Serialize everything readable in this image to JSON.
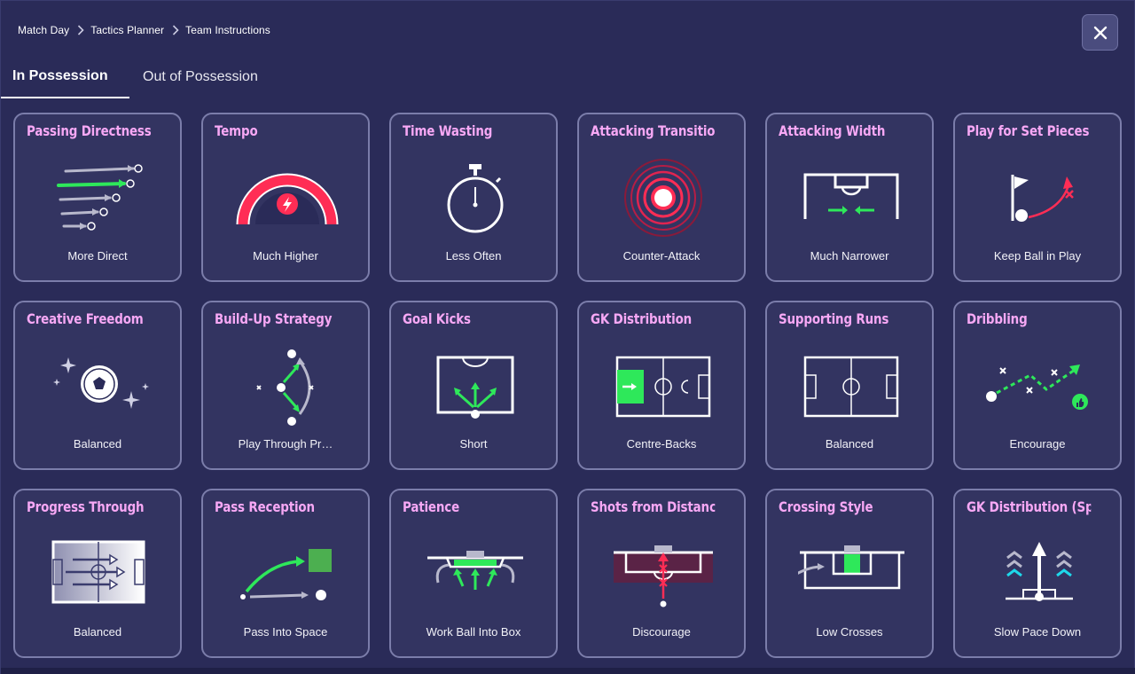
{
  "breadcrumb": [
    "Match Day",
    "Tactics Planner",
    "Team Instructions"
  ],
  "close_label": "×",
  "tabs": {
    "active": "In Possession",
    "inactive": "Out of Possession"
  },
  "colors": {
    "title": "#f7a8f5",
    "accent_green": "#2ee85a",
    "accent_red": "#ff2d55",
    "card_border": "#7b7daa"
  },
  "cards": [
    {
      "title": "Passing Directness",
      "value": "More Direct",
      "icon": "passing-arrows-icon"
    },
    {
      "title": "Tempo",
      "value": "Much Higher",
      "icon": "tempo-gauge-icon"
    },
    {
      "title": "Time Wasting",
      "value": "Less Often",
      "icon": "stopwatch-icon"
    },
    {
      "title": "Attacking Transition",
      "value": "Counter-Attack",
      "icon": "counter-rings-icon"
    },
    {
      "title": "Attacking Width",
      "value": "Much Narrower",
      "icon": "narrow-width-icon"
    },
    {
      "title": "Play for Set Pieces",
      "value": "Keep Ball in Play",
      "icon": "set-piece-flag-icon"
    },
    {
      "title": "Creative Freedom",
      "value": "Balanced",
      "icon": "sparkle-ball-icon"
    },
    {
      "title": "Build-Up Strategy",
      "value": "Play Through Pr…",
      "icon": "build-up-icon"
    },
    {
      "title": "Goal Kicks",
      "value": "Short",
      "icon": "goal-kick-icon"
    },
    {
      "title": "GK Distribution",
      "value": "Centre-Backs",
      "icon": "gk-distribution-pitch-icon"
    },
    {
      "title": "Supporting Runs",
      "value": "Balanced",
      "icon": "supporting-runs-pitch-icon"
    },
    {
      "title": "Dribbling",
      "value": "Encourage",
      "icon": "dribble-path-icon"
    },
    {
      "title": "Progress Through",
      "value": "Balanced",
      "icon": "progress-pitch-icon"
    },
    {
      "title": "Pass Reception",
      "value": "Pass Into Space",
      "icon": "pass-reception-icon"
    },
    {
      "title": "Patience",
      "value": "Work Ball Into Box",
      "icon": "patience-box-icon"
    },
    {
      "title": "Shots from Distance",
      "value": "Discourage",
      "icon": "shots-distance-icon"
    },
    {
      "title": "Crossing Style",
      "value": "Low Crosses",
      "icon": "crossing-style-icon"
    },
    {
      "title": "GK Distribution (Speed)",
      "value": "Slow Pace Down",
      "icon": "gk-speed-icon"
    }
  ]
}
